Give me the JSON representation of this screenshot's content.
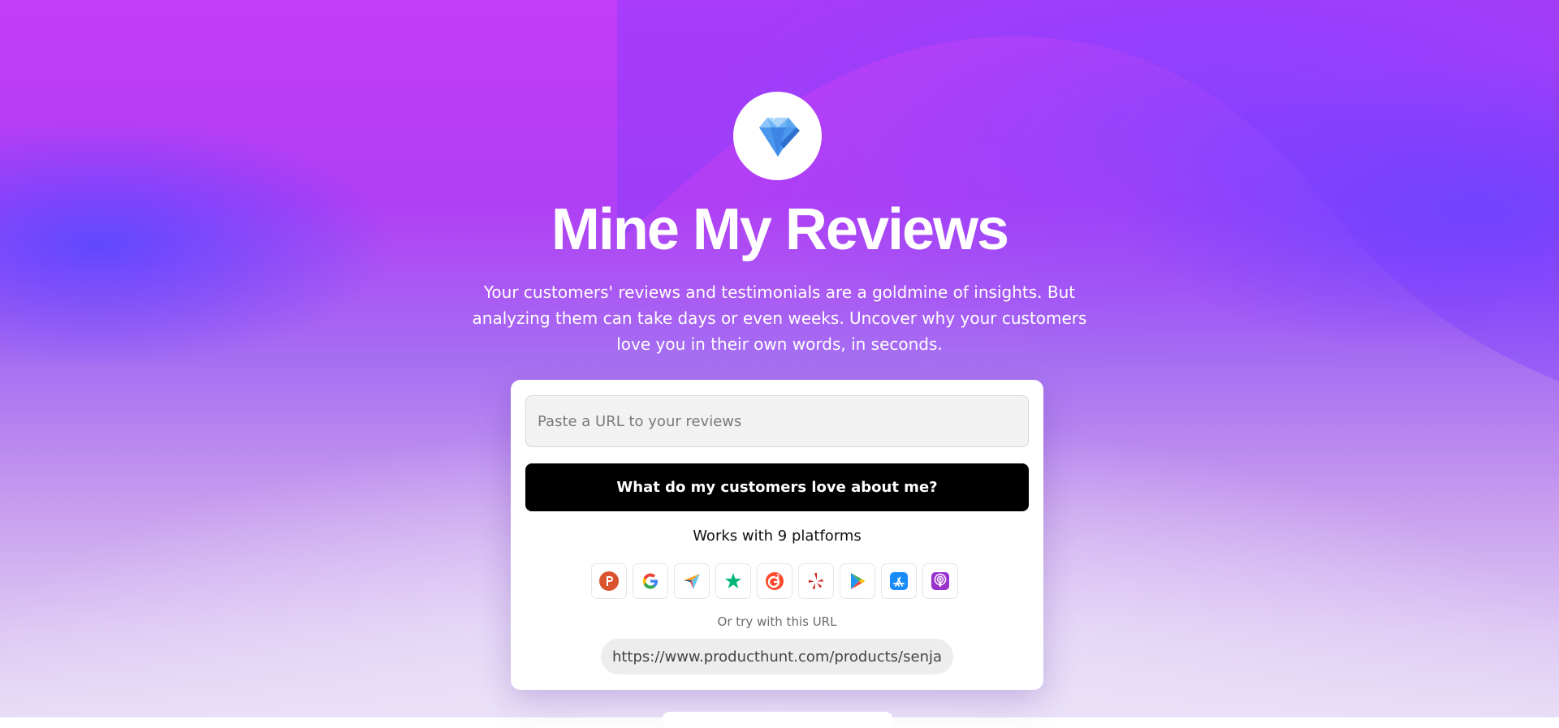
{
  "hero": {
    "title": "Mine My Reviews",
    "subtitle": "Your customers' reviews and testimonials are a goldmine of insights. But analyzing them can take days or even weeks. Uncover why your customers love you in their own words, in seconds."
  },
  "logo": {
    "icon": "diamond-icon"
  },
  "form": {
    "url_placeholder": "Paste a URL to your reviews",
    "url_value": "",
    "submit_label": "What do my customers love about me?"
  },
  "platforms": {
    "label": "Works with 9 platforms",
    "items": [
      {
        "icon": "producthunt-icon",
        "color": "#da552f"
      },
      {
        "icon": "google-icon",
        "color": "#4285f4"
      },
      {
        "icon": "capterra-icon",
        "color": "#ff9d28"
      },
      {
        "icon": "trustpilot-icon",
        "color": "#00b67a"
      },
      {
        "icon": "g2-icon",
        "color": "#ff492c"
      },
      {
        "icon": "yelp-icon",
        "color": "#d32323"
      },
      {
        "icon": "google-play-icon",
        "color": "#01875f"
      },
      {
        "icon": "app-store-icon",
        "color": "#1a8cf8"
      },
      {
        "icon": "apple-podcasts-icon",
        "color": "#9933cc"
      }
    ]
  },
  "try": {
    "label": "Or try with this URL",
    "url": "https://www.producthunt.com/products/senja"
  },
  "colors": {
    "accent": "#b13ef5",
    "button": "#000000"
  }
}
